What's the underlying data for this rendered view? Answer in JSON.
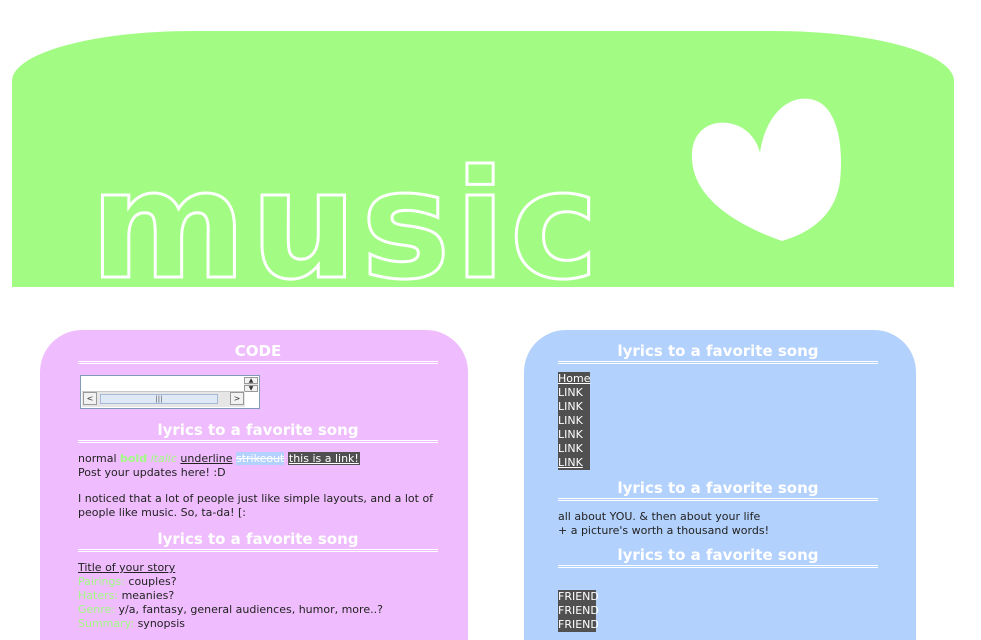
{
  "banner": {
    "word": "music",
    "colors": {
      "banner": "#a2fc84",
      "outline": "#ffffff",
      "heart": "#ffffff"
    },
    "icon": "heart-icon"
  },
  "left": {
    "code_title": "CODE",
    "code_box": {
      "value": "",
      "scroll_grip": "|||",
      "left_arrow": "<",
      "right_arrow": ">"
    },
    "section2_title": "lyrics to a favorite song",
    "styles_demo": {
      "normal": "normal",
      "bold": "bold",
      "italic": "italic",
      "underline": "underline",
      "strike": "strikeout",
      "link": "this is a link!"
    },
    "updates": "Post your updates here! :D",
    "intro": "I noticed that a lot of people just like simple layouts, and a lot of people like music. So, ta-da! [:",
    "section3_title": "lyrics to a favorite song",
    "story": {
      "title": "Title of your story",
      "rows": [
        {
          "label": "Pairings:",
          "value": "couples?"
        },
        {
          "label": "Haters:",
          "value": "meanies?"
        },
        {
          "label": "Genre:",
          "value": "y/a, fantasy, general audiences, humor, more..?"
        },
        {
          "label": "Summary:",
          "value": "synopsis"
        }
      ]
    },
    "colors": {
      "panel": "#efbdfd"
    }
  },
  "right": {
    "section1_title": "lyrics to a favorite song",
    "nav": [
      "Home",
      "LINK",
      "LINK",
      "LINK",
      "LINK",
      "LINK",
      "LINK"
    ],
    "section2_title": "lyrics to a favorite song",
    "about": [
      "all about YOU. & then about your life",
      "+ a picture's worth a thousand words!"
    ],
    "section3_title": "lyrics to a favorite song",
    "friends": [
      "FRIEND",
      "FRIEND",
      "FRIEND"
    ],
    "colors": {
      "panel": "#b3d1fd",
      "link_bg": "#505050"
    }
  }
}
